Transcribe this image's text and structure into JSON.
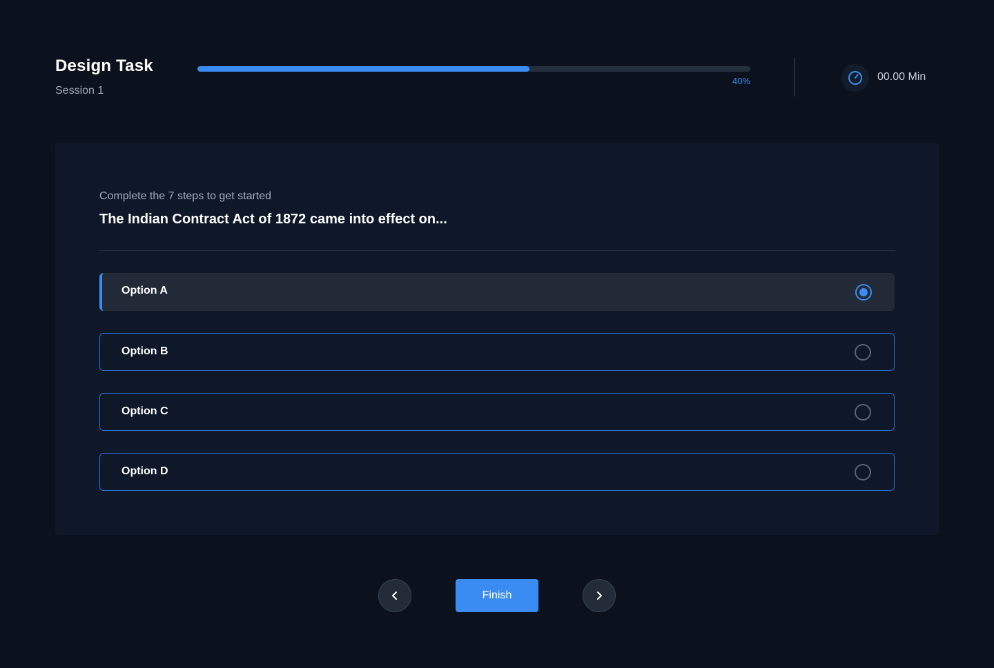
{
  "header": {
    "title": "Design Task",
    "session": "Session 1",
    "progress": {
      "percent": 60,
      "label": "40%"
    },
    "timer": {
      "icon": "timer-icon",
      "text": "00.00 Min"
    }
  },
  "quiz": {
    "instruction": "Complete the 7 steps to get started",
    "question": "The Indian Contract Act of 1872 came into effect on...",
    "options": [
      {
        "label": "Option A",
        "selected": true
      },
      {
        "label": "Option B",
        "selected": false
      },
      {
        "label": "Option C",
        "selected": false
      },
      {
        "label": "Option D",
        "selected": false
      }
    ]
  },
  "navigation": {
    "prev_icon": "chevron-left-icon",
    "next_icon": "chevron-right-icon",
    "finish_label": "Finish"
  },
  "colors": {
    "accent": "#3b8cf2",
    "background": "#0c121d",
    "card": "#0e1828"
  }
}
